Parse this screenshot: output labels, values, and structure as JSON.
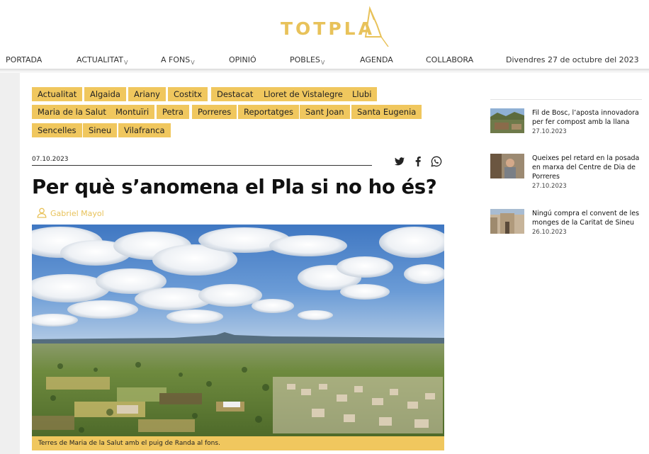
{
  "brand": {
    "logo_text": "TOTPLA",
    "accent_color": "#e8c25a",
    "tag_color": "#f0c75e"
  },
  "nav": {
    "items": [
      {
        "label": "PORTADA",
        "has_caret": false
      },
      {
        "label": "ACTUALITAT",
        "has_caret": true
      },
      {
        "label": "A FONS",
        "has_caret": true
      },
      {
        "label": "OPINIÓ",
        "has_caret": false
      },
      {
        "label": "POBLES",
        "has_caret": true
      },
      {
        "label": "AGENDA",
        "has_caret": false
      },
      {
        "label": "COLLABORA",
        "has_caret": false
      }
    ],
    "caret": "v",
    "date": "Divendres 27 de octubre del 2023"
  },
  "tags": {
    "row1": [
      "Actualitat",
      "Algaida",
      "Ariany",
      "Costitx",
      "Destacat",
      "Lloret de Vistalegre",
      "Llubi"
    ],
    "row2": [
      "Maria de la Salut",
      "Montuïri",
      "Petra",
      "Porreres",
      "Reportatges",
      "Sant Joan",
      "Santa Eugenia"
    ],
    "row3": [
      "Sencelles",
      "Sineu",
      "Vilafranca"
    ]
  },
  "article": {
    "date": "07.10.2023",
    "share_icons": [
      "twitter-icon",
      "facebook-icon",
      "whatsapp-icon"
    ],
    "title": "Per què s’anomena el Pla si no ho és?",
    "author": "Gabriel Mayol",
    "photo_caption": "Terres de Maria de la Salut amb el puig de Randa al fons."
  },
  "sidebar": {
    "items": [
      {
        "title": "Fil de Bosc, l’aposta innovadora per fer compost amb la llana",
        "date": "27.10.2023"
      },
      {
        "title": "Queixes pel retard en la posada en marxa del Centre de Dia de Porreres",
        "date": "27.10.2023"
      },
      {
        "title": "Ningú compra el convent de les monges de la Caritat de Sineu",
        "date": "26.10.2023"
      }
    ]
  }
}
